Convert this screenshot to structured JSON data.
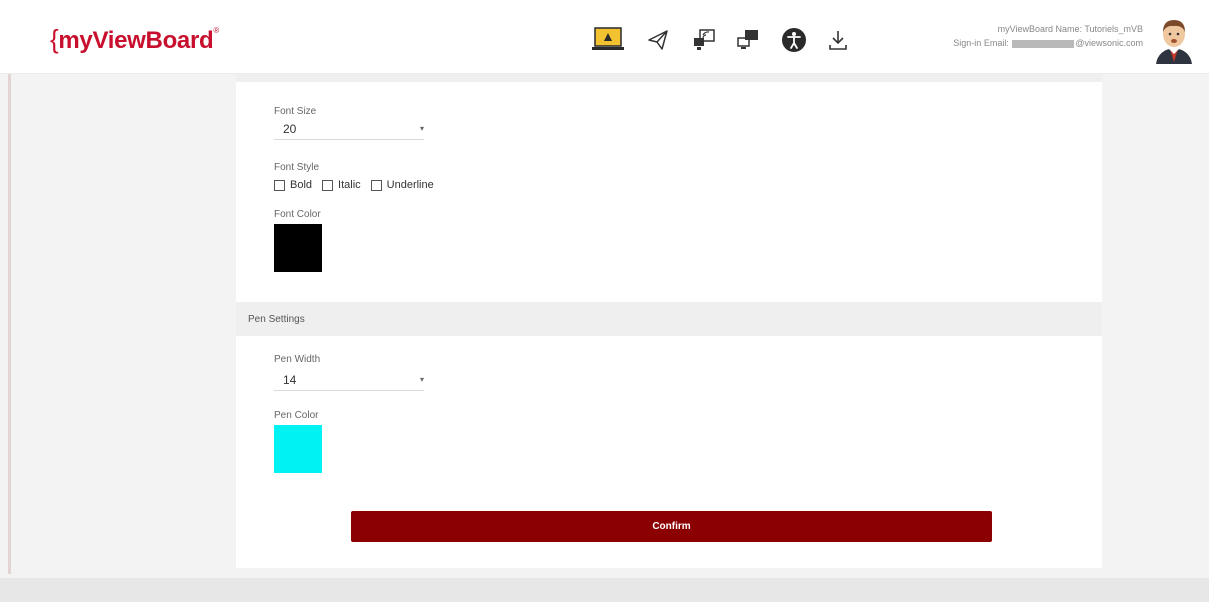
{
  "header": {
    "logo": {
      "brace": "{",
      "text": "myViewBoard",
      "mark": "®"
    },
    "nav_icons": [
      "whiteboard-icon",
      "send-icon",
      "cast-icon",
      "devices-icon",
      "accessibility-icon",
      "download-icon"
    ],
    "user": {
      "name_label": "myViewBoard Name: Tutoriels_mVB",
      "email_prefix": "Sign-in Email:",
      "email_suffix": "@viewsonic.com"
    }
  },
  "text_settings": {
    "font_size_label": "Font Size",
    "font_size_value": "20",
    "font_style_label": "Font Style",
    "styles": [
      {
        "label": "Bold",
        "checked": false
      },
      {
        "label": "Italic",
        "checked": false
      },
      {
        "label": "Underline",
        "checked": false
      }
    ],
    "font_color_label": "Font Color",
    "font_color": "#000000"
  },
  "pen_settings": {
    "title": "Pen Settings",
    "pen_width_label": "Pen Width",
    "pen_width_value": "14",
    "pen_color_label": "Pen Color",
    "pen_color": "#00f2f2"
  },
  "confirm_label": "Confirm",
  "colors": {
    "brand": "#c8102e",
    "confirm": "#8b0000",
    "whiteboard_icon": "#f2c230"
  }
}
